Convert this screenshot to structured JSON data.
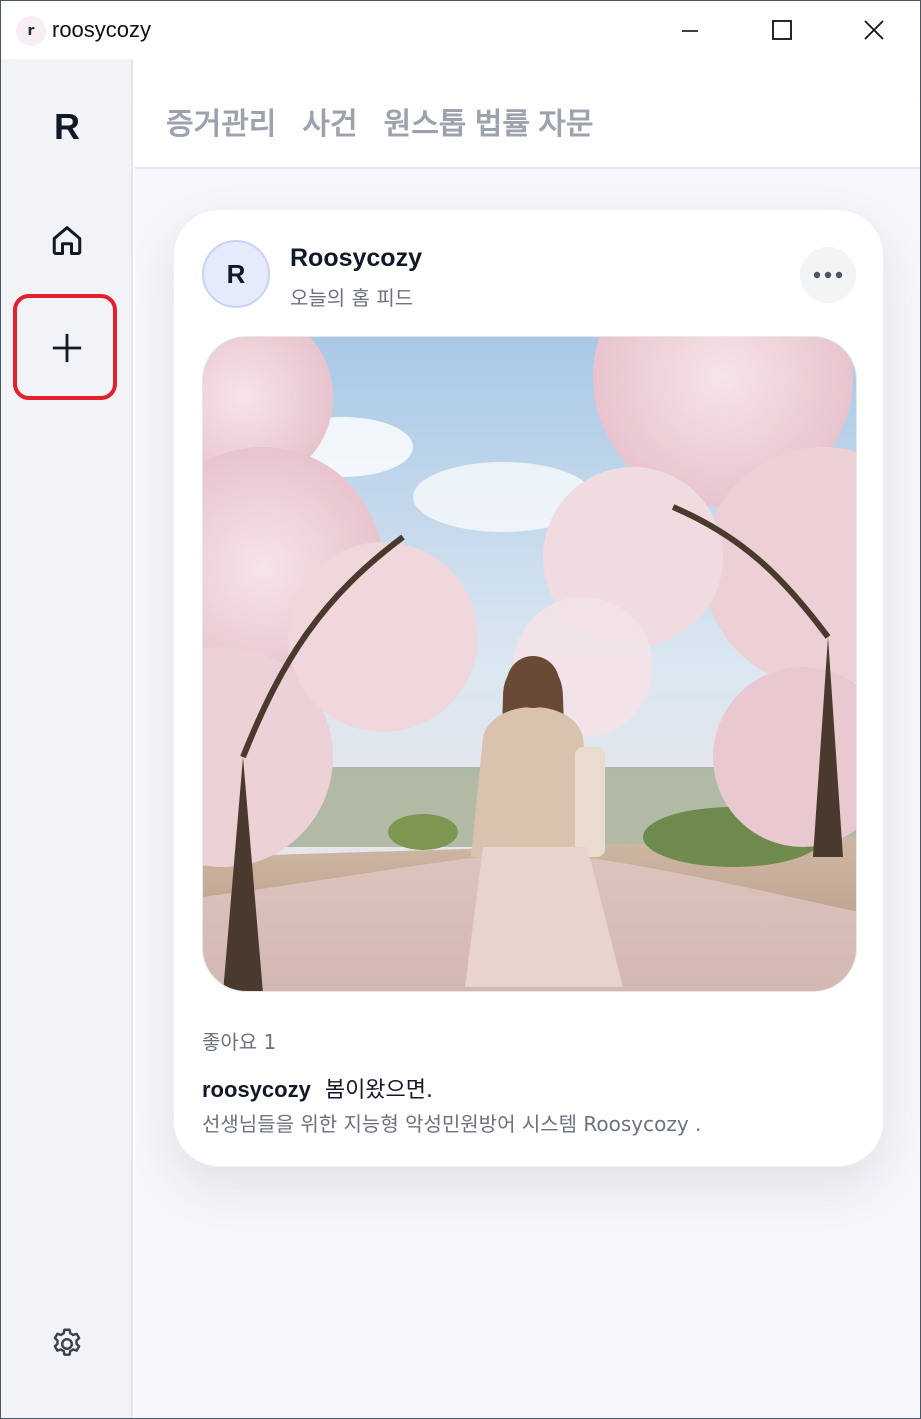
{
  "window": {
    "title": "roosycozy",
    "app_icon_letter": "r"
  },
  "sidebar": {
    "brand_letter": "R",
    "items": [
      {
        "icon": "home-icon"
      },
      {
        "icon": "plus-icon"
      }
    ],
    "settings_icon": "gear-icon"
  },
  "nav": {
    "tabs": [
      "증거관리",
      "사건",
      "원스톱 법률 자문"
    ]
  },
  "post": {
    "avatar_letter": "R",
    "author": "Roosycozy",
    "subtitle": "오늘의 홈 피드",
    "more_icon": "more-horizontal-icon",
    "likes_text": "좋아요 1",
    "caption_user": "roosycozy",
    "caption_text": "봄이왔으면.",
    "description": "선생님들을 위한 지능형 악성민원방어 시스템 Roosycozy ."
  },
  "colors": {
    "accent_highlight": "#e5202e",
    "sidebar_bg": "#f2f3f7",
    "nav_text": "#9ca3af",
    "avatar_bg": "#e6ebfb"
  }
}
